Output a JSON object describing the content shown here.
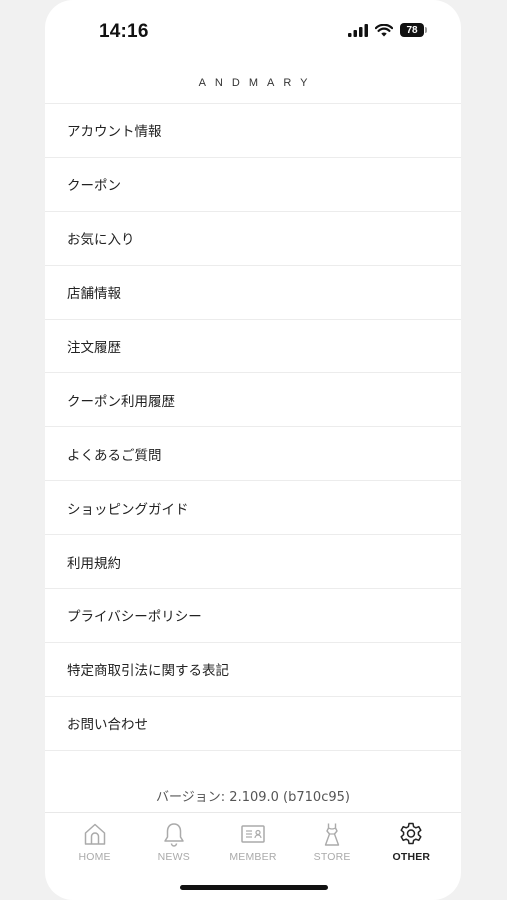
{
  "status_bar": {
    "time": "14:16",
    "battery": "78"
  },
  "header": {
    "brand": "ANDMARY"
  },
  "menu": {
    "items": [
      {
        "label": "アカウント情報"
      },
      {
        "label": "クーポン"
      },
      {
        "label": "お気に入り"
      },
      {
        "label": "店舗情報"
      },
      {
        "label": "注文履歴"
      },
      {
        "label": "クーポン利用履歴"
      },
      {
        "label": "よくあるご質問"
      },
      {
        "label": "ショッピングガイド"
      },
      {
        "label": "利用規約"
      },
      {
        "label": "プライバシーポリシー"
      },
      {
        "label": "特定商取引法に関する表記"
      },
      {
        "label": "お問い合わせ"
      }
    ]
  },
  "footer": {
    "version": "バージョン: 2.109.0 (b710c95)"
  },
  "tab_bar": {
    "tabs": [
      {
        "label": "HOME",
        "icon": "home-icon"
      },
      {
        "label": "NEWS",
        "icon": "bell-icon"
      },
      {
        "label": "MEMBER",
        "icon": "member-card-icon"
      },
      {
        "label": "STORE",
        "icon": "dress-icon"
      },
      {
        "label": "OTHER",
        "icon": "gear-icon"
      }
    ],
    "active": "OTHER",
    "active_color": "#222222",
    "inactive_color": "#aaaaaa"
  }
}
